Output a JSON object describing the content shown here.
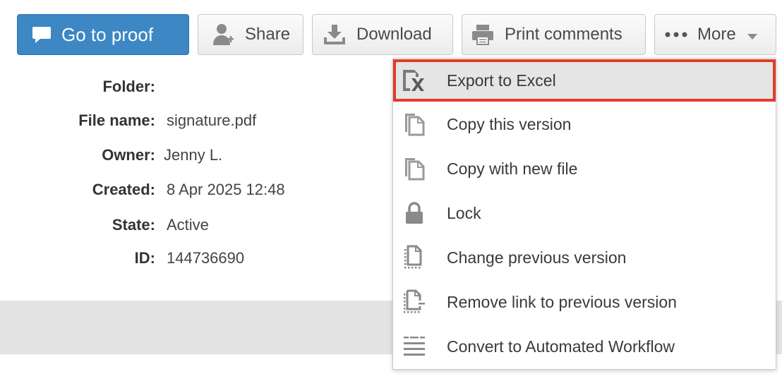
{
  "toolbar": {
    "go_to_proof": "Go to proof",
    "share": "Share",
    "download": "Download",
    "print_comments": "Print comments",
    "more": "More"
  },
  "details": [
    {
      "label": "Folder:",
      "value": ""
    },
    {
      "label": "File name:",
      "value": "signature.pdf"
    },
    {
      "label": "Owner:",
      "value": "Jenny L."
    },
    {
      "label": "Created:",
      "value": "8 Apr 2025 12:48"
    },
    {
      "label": "State:",
      "value": "Active"
    },
    {
      "label": "ID:",
      "value": "144736690"
    }
  ],
  "more_menu": {
    "items": [
      {
        "label": "Export to Excel",
        "icon": "excel-export-icon",
        "highlighted": true
      },
      {
        "label": "Copy this version",
        "icon": "copy-icon"
      },
      {
        "label": "Copy with new file",
        "icon": "copy-icon"
      },
      {
        "label": "Lock",
        "icon": "lock-icon"
      },
      {
        "label": "Change previous version",
        "icon": "document-dotted-icon"
      },
      {
        "label": "Remove link to previous version",
        "icon": "document-unlink-icon"
      },
      {
        "label": "Convert to Automated Workflow",
        "icon": "workflow-icon"
      }
    ]
  },
  "colors": {
    "primary_button": "#3d87c4",
    "highlight_outline": "#e03c2a",
    "highlight_bg": "#e5e5e5"
  }
}
